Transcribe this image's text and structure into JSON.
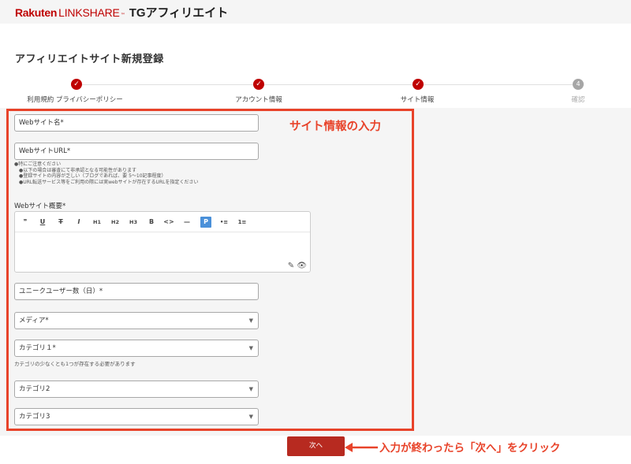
{
  "header": {
    "logo_rakuten": "Rakuten",
    "logo_linkshare": "LINKSHARE",
    "logo_tm": "™",
    "logo_tg": "TGアフィリエイト"
  },
  "page_title": "アフィリエイトサイト新規登録",
  "steps": [
    {
      "label": "利用規約 プライバシーポリシー",
      "status": "done",
      "icon": "check-icon"
    },
    {
      "label": "アカウント情報",
      "status": "done",
      "icon": "check-icon"
    },
    {
      "label": "サイト情報",
      "status": "done",
      "icon": "check-icon"
    },
    {
      "number": "4",
      "label": "確認",
      "status": "pending"
    }
  ],
  "annotation_title": "サイト情報の入力",
  "form": {
    "site_name_placeholder": "Webサイト名*",
    "site_url_placeholder": "WebサイトURL*",
    "notes": [
      "●特にご注意ください",
      "　●以下の場合は審査にて非承認となる可能性があります",
      "　●登録サイトの内容が乏しい（ブログであれば、要 5〜10記事程度）",
      "　●URL転送サービス等をご利用の際には実webサイトが存在するURLを指定ください"
    ],
    "overview_label": "Webサイト概要*",
    "toolbar": [
      "❞",
      "U",
      "T",
      "I",
      "H1",
      "H2",
      "H3",
      "B",
      "<>",
      "—",
      "P",
      "•≡",
      "1≡"
    ],
    "unique_users_placeholder": "ユニークユーザー数（日）*",
    "media_placeholder": "メディア*",
    "category1_placeholder": "カテゴリ１*",
    "category_helper": "カテゴリの少なくとも1つが存在する必要があります",
    "category2_placeholder": "カテゴリ2",
    "category3_placeholder": "カテゴリ3"
  },
  "next_button": "次へ",
  "annotation_next": "入力が終わったら「次へ」をクリック",
  "colors": {
    "brand_red": "#bf0000",
    "annotation_red": "#e8432a",
    "button_red": "#b72a20",
    "active_blue": "#4a90d9"
  }
}
